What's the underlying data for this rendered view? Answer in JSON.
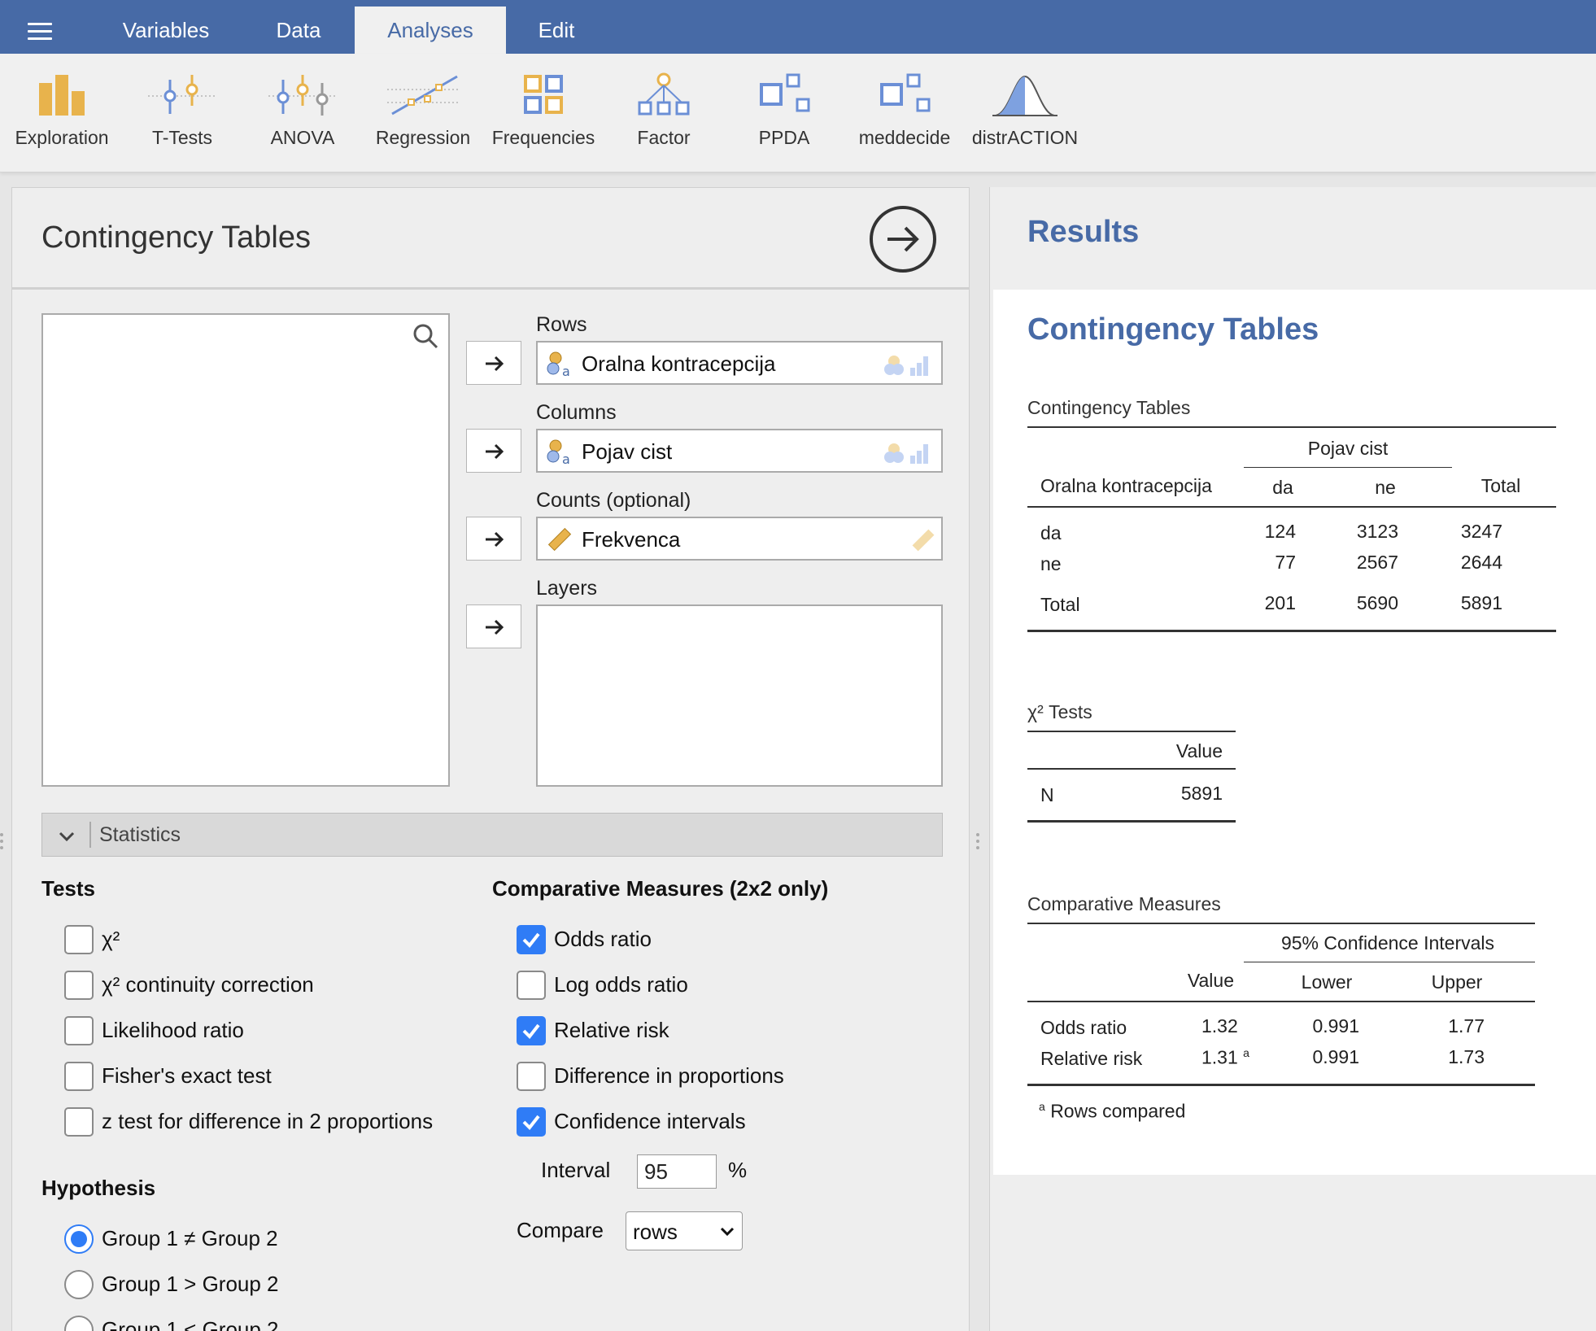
{
  "menu": {
    "tabs": [
      {
        "label": "Variables"
      },
      {
        "label": "Data"
      },
      {
        "label": "Analyses"
      },
      {
        "label": "Edit"
      }
    ],
    "active_tab": "Analyses"
  },
  "ribbon": {
    "items": [
      {
        "label": "Exploration",
        "icon": "exploration-icon"
      },
      {
        "label": "T-Tests",
        "icon": "t-tests-icon"
      },
      {
        "label": "ANOVA",
        "icon": "anova-icon"
      },
      {
        "label": "Regression",
        "icon": "regression-icon"
      },
      {
        "label": "Frequencies",
        "icon": "frequencies-icon"
      },
      {
        "label": "Factor",
        "icon": "factor-icon"
      },
      {
        "label": "PPDA",
        "icon": "ppda-icon"
      },
      {
        "label": "meddecide",
        "icon": "meddecide-icon"
      },
      {
        "label": "distrACTION",
        "icon": "distraction-icon"
      }
    ]
  },
  "options": {
    "title": "Contingency Tables",
    "rows_label": "Rows",
    "rows_var": "Oralna kontracepcija",
    "columns_label": "Columns",
    "columns_var": "Pojav cist",
    "counts_label": "Counts (optional)",
    "counts_var": "Frekvenca",
    "layers_label": "Layers",
    "statistics_label": "Statistics",
    "tests_heading": "Tests",
    "tests": [
      {
        "label": "χ²",
        "checked": false
      },
      {
        "label": "χ² continuity correction",
        "checked": false
      },
      {
        "label": "Likelihood ratio",
        "checked": false
      },
      {
        "label": "Fisher's exact test",
        "checked": false
      },
      {
        "label": "z test for difference in 2 proportions",
        "checked": false
      }
    ],
    "comparative_heading": "Comparative Measures (2x2 only)",
    "comparative": [
      {
        "label": "Odds ratio",
        "checked": true
      },
      {
        "label": "Log odds ratio",
        "checked": false
      },
      {
        "label": "Relative risk",
        "checked": true
      },
      {
        "label": "Difference in proportions",
        "checked": false
      },
      {
        "label": "Confidence intervals",
        "checked": true
      }
    ],
    "interval_label": "Interval",
    "interval_value": "95",
    "interval_unit": "%",
    "compare_label": "Compare",
    "compare_value": "rows",
    "hypothesis_heading": "Hypothesis",
    "hypothesis": [
      {
        "label": "Group 1 ≠ Group 2",
        "checked": true
      },
      {
        "label": "Group 1 > Group 2",
        "checked": false
      },
      {
        "label": "Group 1 < Group 2",
        "checked": false
      }
    ]
  },
  "results": {
    "title": "Results",
    "analysis_title": "Contingency Tables",
    "ct": {
      "caption": "Contingency Tables",
      "col_group": "Pojav cist",
      "row_var": "Oralna kontracepcija",
      "cols": [
        "da",
        "ne",
        "Total"
      ],
      "rows": [
        {
          "label": "da",
          "values": [
            "124",
            "3123",
            "3247"
          ]
        },
        {
          "label": "ne",
          "values": [
            "77",
            "2567",
            "2644"
          ]
        },
        {
          "label": "Total",
          "values": [
            "201",
            "5690",
            "5891"
          ]
        }
      ]
    },
    "chi": {
      "caption": "χ² Tests",
      "col": "Value",
      "row_label": "N",
      "row_value": "5891"
    },
    "cm": {
      "caption": "Comparative Measures",
      "ci_group": "95% Confidence Intervals",
      "cols": [
        "Value",
        "Lower",
        "Upper"
      ],
      "rows": [
        {
          "label": "Odds ratio",
          "value": "1.32",
          "note": "",
          "lower": "0.991",
          "upper": "1.77"
        },
        {
          "label": "Relative risk",
          "value": "1.31",
          "note": "a",
          "lower": "0.991",
          "upper": "1.73"
        }
      ],
      "footnote_mark": "a",
      "footnote": "Rows compared"
    }
  }
}
